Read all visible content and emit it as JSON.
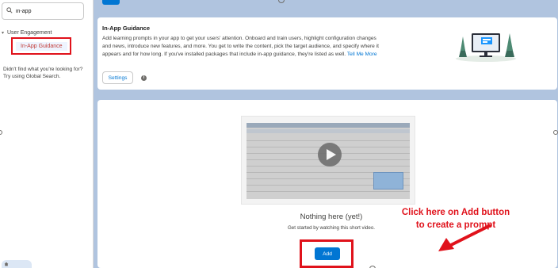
{
  "sidebar": {
    "search": {
      "value": "in-app",
      "icon": "search-icon"
    },
    "tree": {
      "parent_label": "User Engagement",
      "child_label": "In-App Guidance"
    },
    "not_found_line1": "Didn't find what you're looking for?",
    "not_found_line2": "Try using Global Search."
  },
  "header": {
    "title": "In-App Guidance",
    "description": "Add learning prompts in your app to get your users' attention. Onboard and train users, highlight configuration changes and news, introduce new features, and more. You get to write the content, pick the target audience, and specify where it appears and for how long. If you've installed packages that include in-app guidance, they're listed as well.",
    "tell_me_more": "Tell Me More",
    "settings_label": "Settings",
    "info_icon": "info-icon"
  },
  "empty_state": {
    "title": "Nothing here (yet!)",
    "subtitle": "Get started by watching this short video.",
    "add_label": "Add"
  },
  "annotation": {
    "line1": "Click here on Add button",
    "line2": "to create a prompt"
  },
  "colors": {
    "brand": "#0176d3",
    "highlight": "#e0121b",
    "background": "#b0c4df"
  }
}
